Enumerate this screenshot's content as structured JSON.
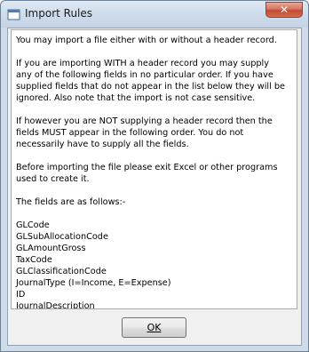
{
  "window": {
    "title": "Import Rules"
  },
  "message": {
    "paragraphs": [
      [
        "You may import a file either with or without a header record."
      ],
      [
        "If you are importing WITH a header record you may supply",
        "any of the following fields in no particular order.  If you have",
        "supplied fields that do not appear in the list below they will be",
        "ignored.  Also note that the import is not case sensitive."
      ],
      [
        "If however you are NOT supplying a header record then the",
        "fields MUST appear in the following order.  You do not",
        "necessarily have to supply all the fields."
      ],
      [
        "Before importing the file please exit Excel or other programs",
        "used to create it."
      ],
      [
        "The fields are as follows:-"
      ]
    ],
    "fields": [
      "GLCode",
      "GLSubAllocationCode",
      "GLAmountGross",
      "TaxCode",
      "GLClassificationCode",
      "JournalType  (I=Income, E=Expense)",
      "ID",
      "JournalDescription"
    ]
  },
  "buttons": {
    "ok_label": "OK"
  },
  "icons": {
    "app": "app-window-icon",
    "close": "close-icon"
  }
}
